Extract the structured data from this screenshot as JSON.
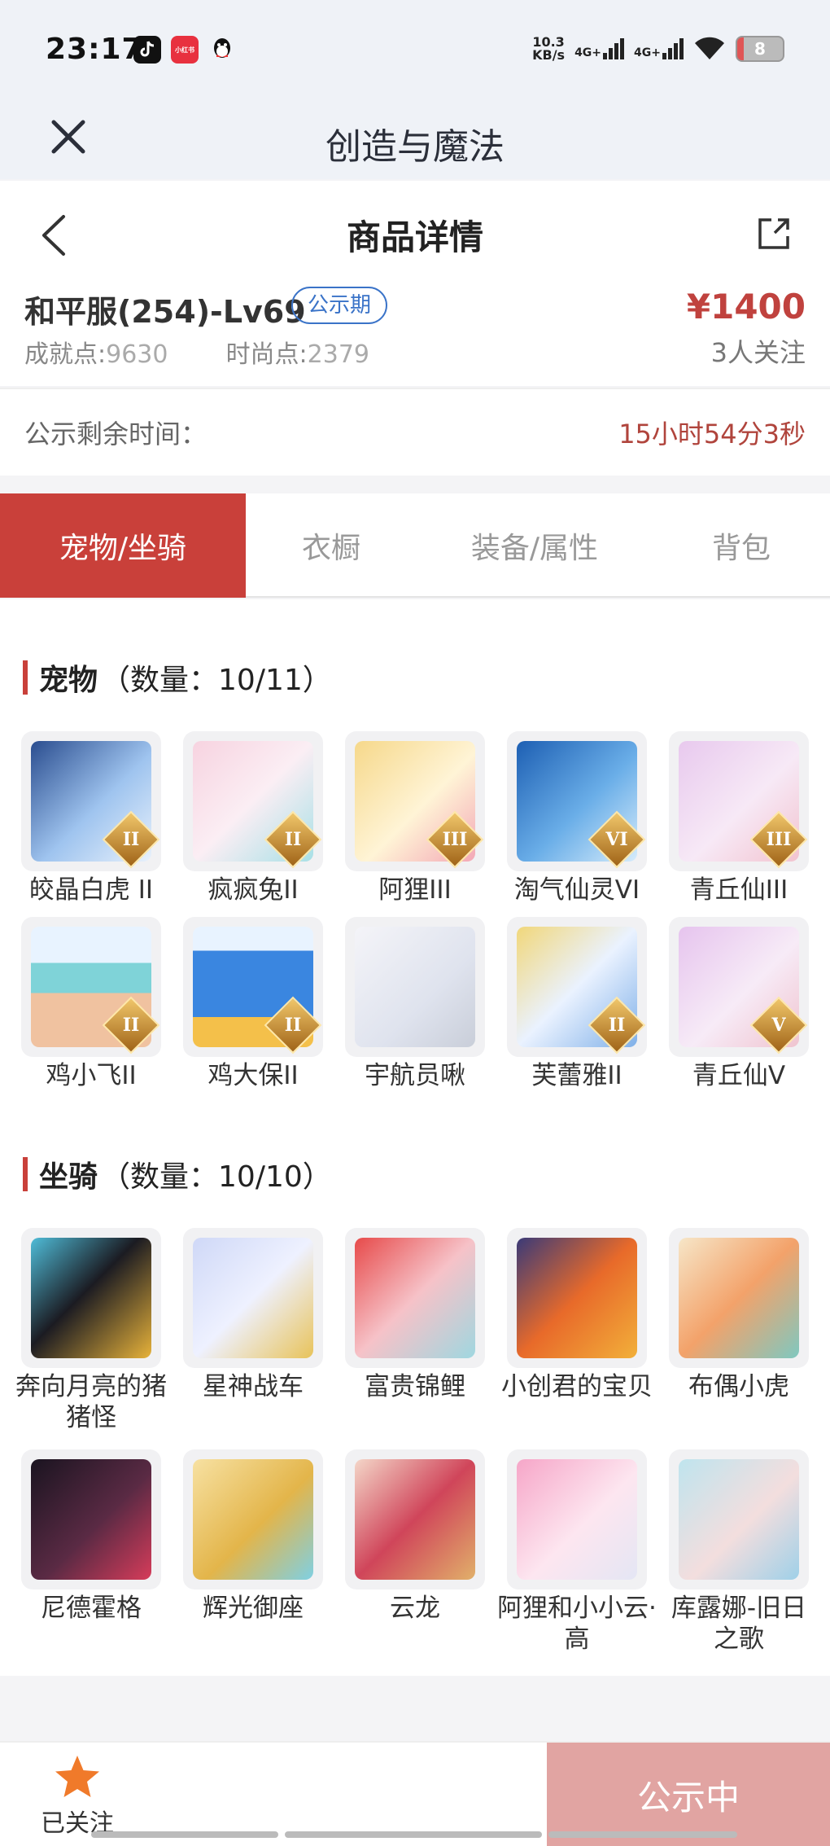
{
  "status_bar": {
    "time": "23:17",
    "net_speed_value": "10.3",
    "net_speed_unit": "KB/s",
    "signal_1": "4G+",
    "signal_2": "4G+",
    "battery": "8",
    "app_icons": [
      "douyin-icon",
      "xiaohongshu-icon",
      "qq-icon"
    ],
    "xhs_text": "小红书"
  },
  "app_bar": {
    "title": "创造与魔法"
  },
  "nav": {
    "title": "商品详情"
  },
  "product": {
    "server": "和平服(254)-Lv69",
    "badge": "公示期",
    "achievement_label": "成就点:",
    "achievement_value": "9630",
    "fashion_label": "时尚点:",
    "fashion_value": "2379",
    "price": "¥1400",
    "followers": "3人关注"
  },
  "countdown": {
    "label": "公示剩余时间：",
    "value": "15小时54分3秒"
  },
  "tabs": [
    {
      "label": "宠物/坐骑",
      "active": true
    },
    {
      "label": "衣橱",
      "active": false
    },
    {
      "label": "装备/属性",
      "active": false
    },
    {
      "label": "背包",
      "active": false
    }
  ],
  "pets": {
    "title": "宠物",
    "count": "（数量：10/11）",
    "items": [
      {
        "name": "皎晶白虎 II",
        "rank": "II"
      },
      {
        "name": "疯疯兔II",
        "rank": "II"
      },
      {
        "name": "阿狸III",
        "rank": "III"
      },
      {
        "name": "淘气仙灵VI",
        "rank": "VI"
      },
      {
        "name": "青丘仙III",
        "rank": "III"
      },
      {
        "name": "鸡小飞II",
        "rank": "II"
      },
      {
        "name": "鸡大保II",
        "rank": "II"
      },
      {
        "name": "宇航员啾",
        "rank": ""
      },
      {
        "name": "芙蕾雅II",
        "rank": "II"
      },
      {
        "name": "青丘仙V",
        "rank": "V"
      }
    ]
  },
  "mounts": {
    "title": "坐骑",
    "count": "（数量：10/10）",
    "items": [
      {
        "name": "奔向月亮的猪猪怪"
      },
      {
        "name": "星神战车"
      },
      {
        "name": "富贵锦鲤"
      },
      {
        "name": "小创君的宝贝"
      },
      {
        "name": "布偶小虎"
      },
      {
        "name": "尼德霍格"
      },
      {
        "name": "辉光御座"
      },
      {
        "name": "云龙"
      },
      {
        "name": "阿狸和小小云·高"
      },
      {
        "name": "库露娜-旧日之歌"
      }
    ]
  },
  "bottom_bar": {
    "follow_label": "已关注",
    "action_label": "公示中"
  },
  "colors": {
    "accent": "#c9403a",
    "price": "#c0423e",
    "badge": "#3a73c8",
    "action_disabled": "#e1a4a2",
    "star": "#f07a2a"
  }
}
